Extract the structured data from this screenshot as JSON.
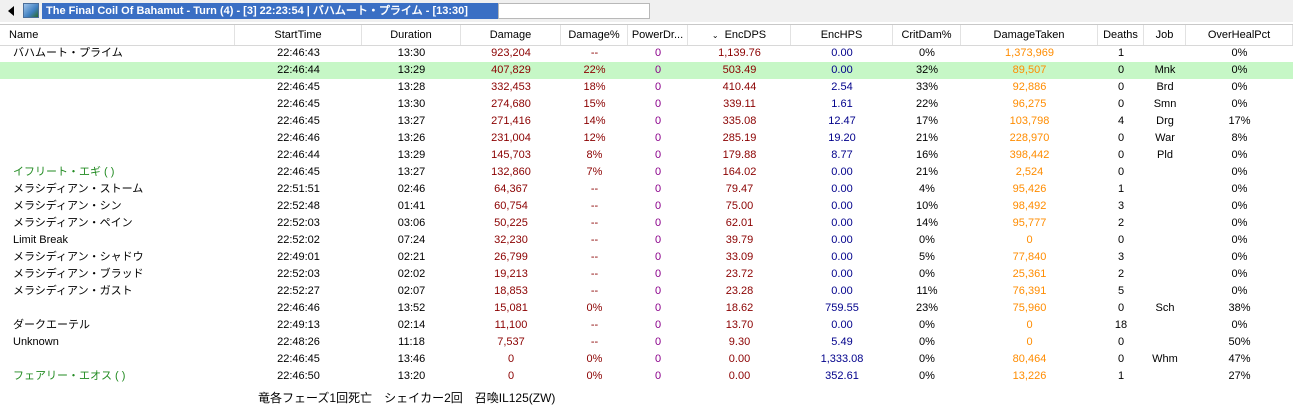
{
  "window": {
    "title": "The Final Coil Of Bahamut - Turn (4) - [3] 22:23:54 | バハムート・プライム - [13:30]",
    "icons": {
      "back": "back-arrow-icon",
      "app": "encounter-image-icon"
    }
  },
  "table": {
    "sort_indicator": "⌄",
    "columns": [
      {
        "key": "name",
        "label": "Name"
      },
      {
        "key": "start",
        "label": "StartTime"
      },
      {
        "key": "duration",
        "label": "Duration"
      },
      {
        "key": "damage",
        "label": "Damage"
      },
      {
        "key": "damage_pct",
        "label": "Damage%"
      },
      {
        "key": "power",
        "label": "PowerDr..."
      },
      {
        "key": "encdps",
        "label": "EncDPS"
      },
      {
        "key": "enchps",
        "label": "EncHPS"
      },
      {
        "key": "critdam",
        "label": "CritDam%"
      },
      {
        "key": "taken",
        "label": "DamageTaken"
      },
      {
        "key": "deaths",
        "label": "Deaths"
      },
      {
        "key": "job",
        "label": "Job"
      },
      {
        "key": "overheal",
        "label": "OverHealPct"
      }
    ],
    "rows": [
      {
        "name": "バハムート・プライム",
        "start": "22:46:43",
        "duration": "13:30",
        "damage": "923,204",
        "damage_pct": "--",
        "power": "0",
        "encdps": "1,139.76",
        "enchps": "0.00",
        "critdam": "0%",
        "taken": "1,373,969",
        "deaths": "1",
        "job": "",
        "overheal": "0%"
      },
      {
        "name": "",
        "start": "22:46:44",
        "duration": "13:29",
        "damage": "407,829",
        "damage_pct": "22%",
        "power": "0",
        "encdps": "503.49",
        "enchps": "0.00",
        "critdam": "32%",
        "taken": "89,507",
        "deaths": "0",
        "job": "Mnk",
        "overheal": "0%",
        "highlight": true
      },
      {
        "name": "",
        "start": "22:46:45",
        "duration": "13:28",
        "damage": "332,453",
        "damage_pct": "18%",
        "power": "0",
        "encdps": "410.44",
        "enchps": "2.54",
        "critdam": "33%",
        "taken": "92,886",
        "deaths": "0",
        "job": "Brd",
        "overheal": "0%"
      },
      {
        "name": "",
        "start": "22:46:45",
        "duration": "13:30",
        "damage": "274,680",
        "damage_pct": "15%",
        "power": "0",
        "encdps": "339.11",
        "enchps": "1.61",
        "critdam": "22%",
        "taken": "96,275",
        "deaths": "0",
        "job": "Smn",
        "overheal": "0%"
      },
      {
        "name": "",
        "start": "22:46:45",
        "duration": "13:27",
        "damage": "271,416",
        "damage_pct": "14%",
        "power": "0",
        "encdps": "335.08",
        "enchps": "12.47",
        "critdam": "17%",
        "taken": "103,798",
        "deaths": "4",
        "job": "Drg",
        "overheal": "17%"
      },
      {
        "name": "",
        "start": "22:46:46",
        "duration": "13:26",
        "damage": "231,004",
        "damage_pct": "12%",
        "power": "0",
        "encdps": "285.19",
        "enchps": "19.20",
        "critdam": "21%",
        "taken": "228,970",
        "deaths": "0",
        "job": "War",
        "overheal": "8%"
      },
      {
        "name": "",
        "start": "22:46:44",
        "duration": "13:29",
        "damage": "145,703",
        "damage_pct": "8%",
        "power": "0",
        "encdps": "179.88",
        "enchps": "8.77",
        "critdam": "16%",
        "taken": "398,442",
        "deaths": "0",
        "job": "Pld",
        "overheal": "0%"
      },
      {
        "name": "イフリート・エギ (                    )",
        "start": "22:46:45",
        "duration": "13:27",
        "damage": "132,860",
        "damage_pct": "7%",
        "power": "0",
        "encdps": "164.02",
        "enchps": "0.00",
        "critdam": "21%",
        "taken": "2,524",
        "deaths": "0",
        "job": "",
        "overheal": "0%",
        "pet": true
      },
      {
        "name": "メラシディアン・ストーム",
        "start": "22:51:51",
        "duration": "02:46",
        "damage": "64,367",
        "damage_pct": "--",
        "power": "0",
        "encdps": "79.47",
        "enchps": "0.00",
        "critdam": "4%",
        "taken": "95,426",
        "deaths": "1",
        "job": "",
        "overheal": "0%"
      },
      {
        "name": "メラシディアン・シン",
        "start": "22:52:48",
        "duration": "01:41",
        "damage": "60,754",
        "damage_pct": "--",
        "power": "0",
        "encdps": "75.00",
        "enchps": "0.00",
        "critdam": "10%",
        "taken": "98,492",
        "deaths": "3",
        "job": "",
        "overheal": "0%"
      },
      {
        "name": "メラシディアン・ペイン",
        "start": "22:52:03",
        "duration": "03:06",
        "damage": "50,225",
        "damage_pct": "--",
        "power": "0",
        "encdps": "62.01",
        "enchps": "0.00",
        "critdam": "14%",
        "taken": "95,777",
        "deaths": "2",
        "job": "",
        "overheal": "0%"
      },
      {
        "name": "Limit Break",
        "start": "22:52:02",
        "duration": "07:24",
        "damage": "32,230",
        "damage_pct": "--",
        "power": "0",
        "encdps": "39.79",
        "enchps": "0.00",
        "critdam": "0%",
        "taken": "0",
        "deaths": "0",
        "job": "",
        "overheal": "0%"
      },
      {
        "name": "メラシディアン・シャドウ",
        "start": "22:49:01",
        "duration": "02:21",
        "damage": "26,799",
        "damage_pct": "--",
        "power": "0",
        "encdps": "33.09",
        "enchps": "0.00",
        "critdam": "5%",
        "taken": "77,840",
        "deaths": "3",
        "job": "",
        "overheal": "0%"
      },
      {
        "name": "メラシディアン・ブラッド",
        "start": "22:52:03",
        "duration": "02:02",
        "damage": "19,213",
        "damage_pct": "--",
        "power": "0",
        "encdps": "23.72",
        "enchps": "0.00",
        "critdam": "0%",
        "taken": "25,361",
        "deaths": "2",
        "job": "",
        "overheal": "0%"
      },
      {
        "name": "メラシディアン・ガスト",
        "start": "22:52:27",
        "duration": "02:07",
        "damage": "18,853",
        "damage_pct": "--",
        "power": "0",
        "encdps": "23.28",
        "enchps": "0.00",
        "critdam": "11%",
        "taken": "76,391",
        "deaths": "5",
        "job": "",
        "overheal": "0%"
      },
      {
        "name": "",
        "start": "22:46:46",
        "duration": "13:52",
        "damage": "15,081",
        "damage_pct": "0%",
        "power": "0",
        "encdps": "18.62",
        "enchps": "759.55",
        "critdam": "23%",
        "taken": "75,960",
        "deaths": "0",
        "job": "Sch",
        "overheal": "38%"
      },
      {
        "name": "ダークエーテル",
        "start": "22:49:13",
        "duration": "02:14",
        "damage": "11,100",
        "damage_pct": "--",
        "power": "0",
        "encdps": "13.70",
        "enchps": "0.00",
        "critdam": "0%",
        "taken": "0",
        "deaths": "18",
        "job": "",
        "overheal": "0%"
      },
      {
        "name": "Unknown",
        "start": "22:48:26",
        "duration": "11:18",
        "damage": "7,537",
        "damage_pct": "--",
        "power": "0",
        "encdps": "9.30",
        "enchps": "5.49",
        "critdam": "0%",
        "taken": "0",
        "deaths": "0",
        "job": "",
        "overheal": "50%"
      },
      {
        "name": "",
        "start": "22:46:45",
        "duration": "13:46",
        "damage": "0",
        "damage_pct": "0%",
        "power": "0",
        "encdps": "0.00",
        "enchps": "1,333.08",
        "critdam": "0%",
        "taken": "80,464",
        "deaths": "0",
        "job": "Whm",
        "overheal": "47%"
      },
      {
        "name": "フェアリー・エオス (                    )",
        "start": "22:46:50",
        "duration": "13:20",
        "damage": "0",
        "damage_pct": "0%",
        "power": "0",
        "encdps": "0.00",
        "enchps": "352.61",
        "critdam": "0%",
        "taken": "13,226",
        "deaths": "1",
        "job": "",
        "overheal": "27%",
        "pet": true
      }
    ]
  },
  "footer": {
    "note": "竜各フェーズ1回死亡　シェイカー2回　召喚IL125(ZW)"
  }
}
